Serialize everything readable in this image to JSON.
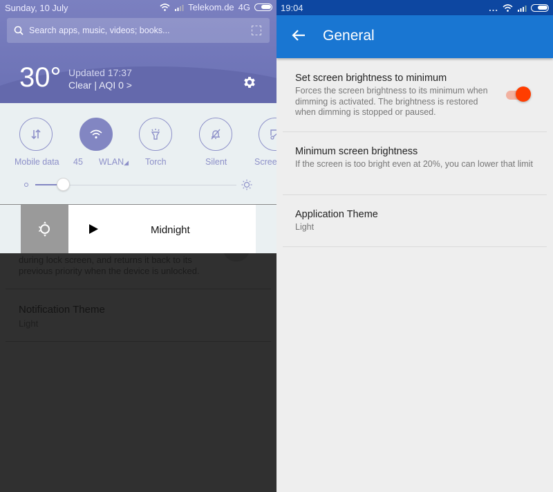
{
  "left": {
    "status_bar": {
      "date": "Sunday, 10 July",
      "carrier": "Telekom.de",
      "network": "4G"
    },
    "search": {
      "placeholder": "Search apps, music, videos; books..."
    },
    "weather": {
      "temperature": "30°",
      "updated": "Updated 17:37",
      "condition": "Clear | AQI 0 >"
    },
    "quick_tiles": [
      {
        "label": "Mobile data",
        "icon": "mobile-data-icon",
        "active": false
      },
      {
        "label": "WLAN",
        "icon": "wifi-icon",
        "active": true,
        "prefix": "45"
      },
      {
        "label": "Torch",
        "icon": "torch-icon",
        "active": false
      },
      {
        "label": "Silent",
        "icon": "silent-bell-icon",
        "active": false
      },
      {
        "label": "Scree",
        "icon": "screenshot-icon",
        "active": false
      }
    ],
    "brightness": {
      "value_percent": 14
    },
    "media_notification": {
      "title": "Midnight"
    },
    "dimmed_settings": {
      "partial_summary": "during lock screen, and returns it back to its previous priority when the device is unlocked.",
      "notification_theme_title": "Notification Theme",
      "notification_theme_value": "Light"
    }
  },
  "right": {
    "status_bar": {
      "time": "19:04",
      "overflow": "..."
    },
    "app_bar": {
      "title": "General"
    },
    "preferences": [
      {
        "title": "Set screen brightness to minimum",
        "summary": "Forces the screen brightness to its minimum when dimming is activated. The brightness is restored when dimming is stopped or paused.",
        "switch_on": true
      },
      {
        "title": "Minimum screen brightness",
        "summary": "If the screen is too bright even at 20%, you can lower that limit"
      },
      {
        "title": "Application Theme",
        "summary": "Light"
      }
    ],
    "colors": {
      "status_bar": "#0d47a1",
      "app_bar": "#1976d2",
      "accent": "#ff3d00"
    }
  }
}
